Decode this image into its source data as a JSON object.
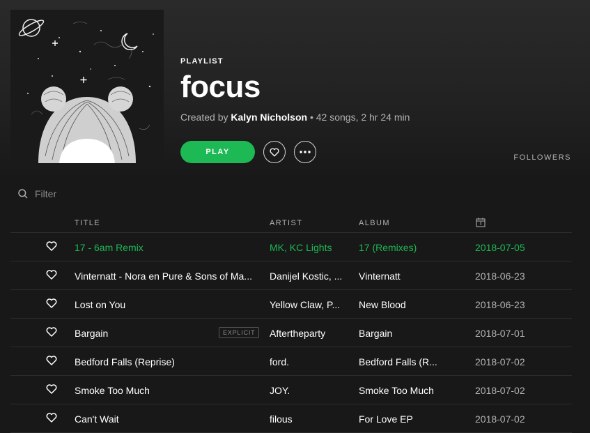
{
  "playlist": {
    "type_label": "PLAYLIST",
    "title": "focus",
    "created_prefix": "Created by ",
    "author": "Kalyn Nicholson",
    "stats": " • 42 songs, 2 hr 24 min",
    "play_label": "PLAY",
    "followers_label": "FOLLOWERS"
  },
  "filter": {
    "placeholder": "Filter"
  },
  "columns": {
    "title": "TITLE",
    "artist": "ARTIST",
    "album": "ALBUM"
  },
  "tracks": [
    {
      "title": "17 - 6am Remix",
      "artist": "MK, KC Lights",
      "album": "17 (Remixes)",
      "date": "2018-07-05"
    },
    {
      "title": "Vinternatt - Nora en Pure & Sons of Ma...",
      "artist": "Danijel Kostic, ...",
      "album": "Vinternatt",
      "date": "2018-06-23"
    },
    {
      "title": "Lost on You",
      "artist": "Yellow Claw, P...",
      "album": "New Blood",
      "date": "2018-06-23"
    },
    {
      "title": "Bargain",
      "explicit": "EXPLICIT",
      "artist": "Aftertheparty",
      "album": "Bargain",
      "date": "2018-07-01"
    },
    {
      "title": "Bedford Falls (Reprise)",
      "artist": "ford.",
      "album": "Bedford Falls (R...",
      "date": "2018-07-02"
    },
    {
      "title": "Smoke Too Much",
      "artist": "JOY.",
      "album": "Smoke Too Much",
      "date": "2018-07-02"
    },
    {
      "title": "Can't Wait",
      "artist": "filous",
      "album": "For Love EP",
      "date": "2018-07-02"
    }
  ],
  "colors": {
    "accent": "#1db954",
    "background": "#181818",
    "muted": "#b3b3b3"
  },
  "icons": {
    "search": "search-icon",
    "heart": "heart-icon",
    "more": "more-icon",
    "calendar": "calendar-icon"
  }
}
